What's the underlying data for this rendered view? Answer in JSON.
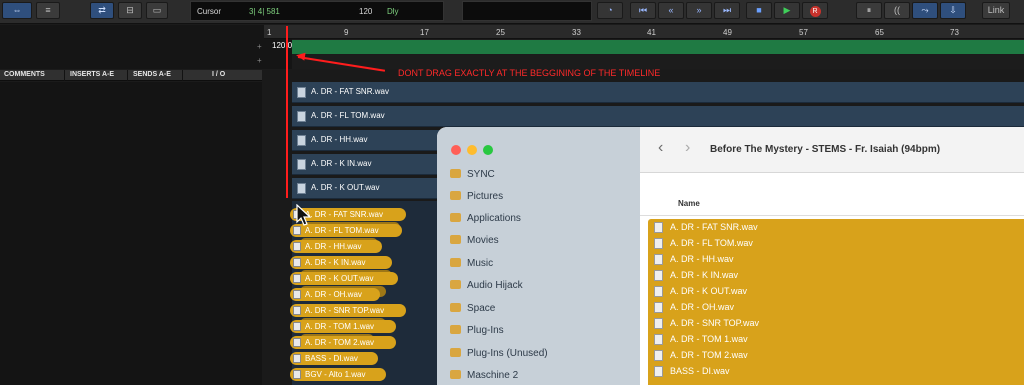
{
  "toolbar": {
    "cursor_label": "Cursor",
    "cursor_value": "3| 4| 581",
    "tempo_value": "120",
    "dly_label": "Dly",
    "link_label": "Link"
  },
  "ruler": {
    "bars": [
      "1",
      "9",
      "17",
      "25",
      "33",
      "41",
      "49",
      "57",
      "65",
      "73"
    ],
    "tempo_marker": "120.0"
  },
  "columns": [
    "COMMENTS",
    "INSERTS A-E",
    "SENDS A-E",
    "I / O"
  ],
  "annotation": "DONT DRAG EXACTLY AT THE BEGGINING OF THE TIMELINE",
  "tracks": [
    "A. DR - FAT SNR.wav",
    "A. DR - FL TOM.wav",
    "A. DR - HH.wav",
    "A. DR - K IN.wav",
    "A. DR - K OUT.wav"
  ],
  "drag_items": [
    "A. DR - FAT SNR.wav",
    "A. DR - FL TOM.wav",
    "A. DR - HH.wav",
    "A. DR - K IN.wav",
    "A. DR - K OUT.wav",
    "A. DR - OH.wav",
    "A. DR - SNR TOP.wav",
    "A. DR - TOM 1.wav",
    "A. DR - TOM 2.wav",
    "BASS - DI.wav",
    "BGV - Alto 1.wav"
  ],
  "finder": {
    "title": "Before The Mystery - STEMS - Fr. Isaiah (94bpm)",
    "back": "‹",
    "forward": "›",
    "name_header": "Name",
    "sidebar": [
      "SYNC",
      "Pictures",
      "Applications",
      "Movies",
      "Music",
      "Audio Hijack",
      "Space",
      "Plug-Ins",
      "Plug-Ins (Unused)",
      "Maschine 2"
    ],
    "files": [
      "A. DR - FAT SNR.wav",
      "A. DR - FL TOM.wav",
      "A. DR - HH.wav",
      "A. DR - K IN.wav",
      "A. DR - K OUT.wav",
      "A. DR - OH.wav",
      "A. DR - SNR TOP.wav",
      "A. DR - TOM 1.wav",
      "A. DR - TOM 2.wav",
      "BASS - DI.wav"
    ]
  }
}
